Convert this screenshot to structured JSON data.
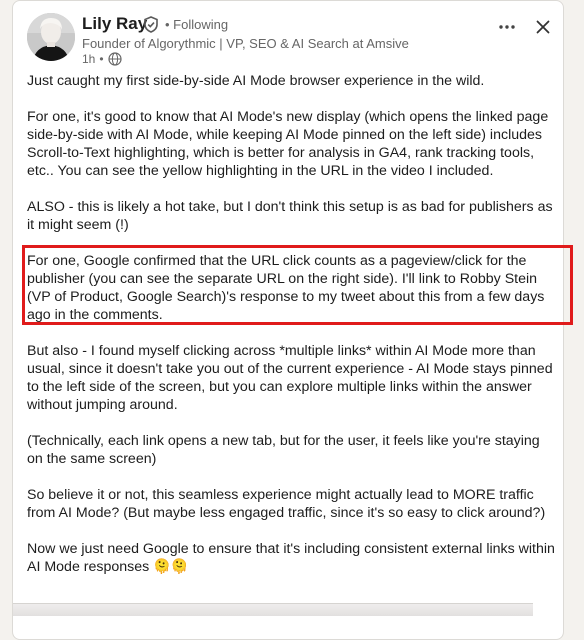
{
  "author": {
    "name": "Lily Ray",
    "follow_status": "• Following",
    "headline": "Founder of Algorythmic | VP, SEO & AI Search at Amsive",
    "time": "1h",
    "dot": "•"
  },
  "actions": {
    "more_label": "•••",
    "close_label": "✕"
  },
  "post": {
    "paragraphs": [
      "Just caught my first side-by-side AI Mode browser experience in the wild.",
      "For one, it's good to know that AI Mode's new display (which opens the linked page side-by-side with AI Mode, while keeping AI Mode pinned on the left side) includes Scroll-to-Text highlighting, which is better for analysis in GA4, rank tracking tools, etc.. You can see the yellow highlighting in the URL in the video I included.",
      "ALSO - this is likely a hot take, but I don't think this setup is as bad for publishers as it might seem (!)",
      "For one, Google confirmed that the URL click counts as a pageview/click for the publisher (you can see the separate URL on the right side). I'll link to Robby Stein (VP of Product, Google Search)'s response to my tweet about this from a few days ago in the comments.",
      "But also - I found myself clicking across *multiple links* within AI Mode more than usual, since it doesn't take you out of the current experience - AI Mode stays pinned to the left side of the screen, but you can explore multiple links within the answer without jumping around.",
      "(Technically, each link opens a new tab, but for the user, it feels like you're staying on the same screen)",
      "So believe it or not, this seamless experience might actually lead to MORE traffic from AI Mode?  (But maybe less engaged traffic, since it's so easy to click around?)",
      "Now we just need Google to ensure that it's including consistent external links within AI Mode responses 🫠🫠"
    ]
  },
  "colors": {
    "highlight_border": "#e01b1b",
    "page_background": "#f4f2ee",
    "text": "#1d1d1d",
    "muted_text": "#666666"
  }
}
